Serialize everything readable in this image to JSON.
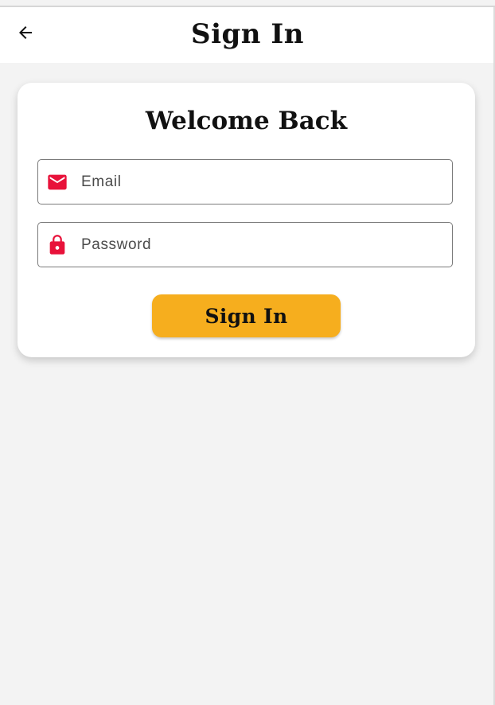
{
  "app_bar": {
    "title": "Sign In",
    "back_icon": "arrow-back-icon"
  },
  "card": {
    "title": "Welcome Back",
    "email": {
      "placeholder": "Email",
      "value": "",
      "icon": "mail-icon"
    },
    "password": {
      "placeholder": "Password",
      "value": "",
      "icon": "lock-icon"
    },
    "submit_label": "Sign In"
  },
  "colors": {
    "accent": "#f6ae1e",
    "icon_red": "#e8123a",
    "background": "#f3f3f3",
    "card": "#ffffff"
  }
}
